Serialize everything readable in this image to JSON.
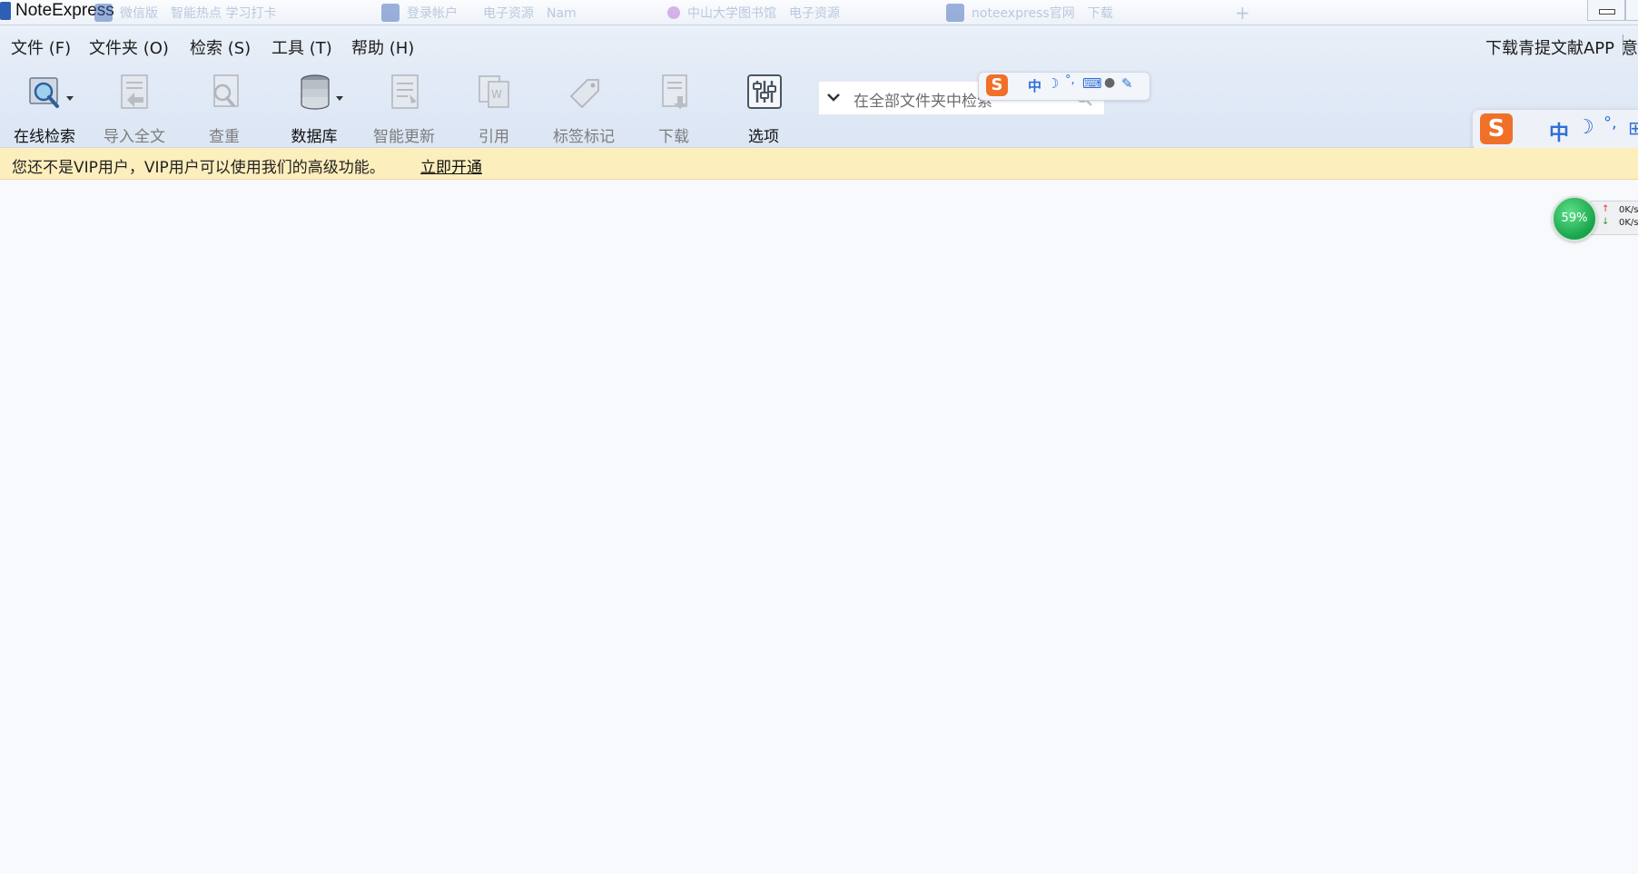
{
  "window": {
    "title": "NoteExpress",
    "background_tabs": [
      "微信版　智能热点 学习打卡",
      "登录帐户　　电子资源　Nam",
      "中山大学图书馆　电子资源",
      "noteexpress官网　下载"
    ]
  },
  "menubar": {
    "items": [
      "文件 (F)",
      "文件夹 (O)",
      "检索 (S)",
      "工具 (T)",
      "帮助 (H)"
    ],
    "right_link": "下载青提文献APP",
    "right_cut": "意"
  },
  "toolbar": {
    "buttons": [
      {
        "label": "在线检索",
        "icon": "online-search-icon",
        "enabled": true,
        "dropdown": true
      },
      {
        "label": "导入全文",
        "icon": "import-fulltext-icon",
        "enabled": false,
        "dropdown": false
      },
      {
        "label": "查重",
        "icon": "duplicate-check-icon",
        "enabled": false,
        "dropdown": false
      },
      {
        "label": "数据库",
        "icon": "database-icon",
        "enabled": true,
        "dropdown": true
      },
      {
        "label": "智能更新",
        "icon": "smart-update-icon",
        "enabled": false,
        "dropdown": false
      },
      {
        "label": "引用",
        "icon": "cite-icon",
        "enabled": false,
        "dropdown": false
      },
      {
        "label": "标签标记",
        "icon": "tag-icon",
        "enabled": false,
        "dropdown": false
      },
      {
        "label": "下载",
        "icon": "download-icon",
        "enabled": false,
        "dropdown": false
      },
      {
        "label": "选项",
        "icon": "options-icon",
        "enabled": true,
        "dropdown": false
      }
    ],
    "search": {
      "placeholder": "在全部文件夹中检索"
    }
  },
  "ime": {
    "logo": "S",
    "mode": "中",
    "punct": "°,"
  },
  "vip_banner": {
    "text": "您还不是VIP用户，VIP用户可以使用我们的高级功能。",
    "link": "立即开通"
  },
  "net_monitor": {
    "percent": "59%",
    "up": "0K/s",
    "down": "0K/s"
  },
  "colors": {
    "banner_bg": "#fdeebd",
    "toolbar_bg": "#dce6f4",
    "ime_logo": "#f07028",
    "ime_accent": "#2f6fd6"
  }
}
